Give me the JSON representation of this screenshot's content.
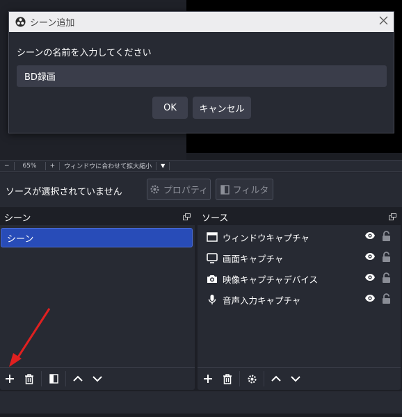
{
  "zoom_bar": {
    "minus": "−",
    "zoom_level": "65%",
    "plus": "+",
    "fit_label": "ウィンドウに合わせて拡大縮小",
    "dropdown": "▼"
  },
  "properties_bar": {
    "no_source": "ソースが選択されていません",
    "properties": "プロパティ",
    "filters": "フィルタ"
  },
  "scenes": {
    "title": "シーン",
    "items": [
      "シーン"
    ]
  },
  "sources": {
    "title": "ソース",
    "items": [
      {
        "label": "ウィンドウキャプチャ",
        "icon": "window-icon"
      },
      {
        "label": "画面キャプチャ",
        "icon": "monitor-icon"
      },
      {
        "label": "映像キャプチャデバイス",
        "icon": "camera-icon"
      },
      {
        "label": "音声入力キャプチャ",
        "icon": "microphone-icon"
      }
    ]
  },
  "dialog": {
    "title": "シーン追加",
    "prompt": "シーンの名前を入力してください",
    "input_value": "BD録画",
    "ok": "OK",
    "cancel": "キャンセル"
  },
  "colors": {
    "accent_selected": "#284cb8",
    "annotation_arrow": "#e02020"
  }
}
